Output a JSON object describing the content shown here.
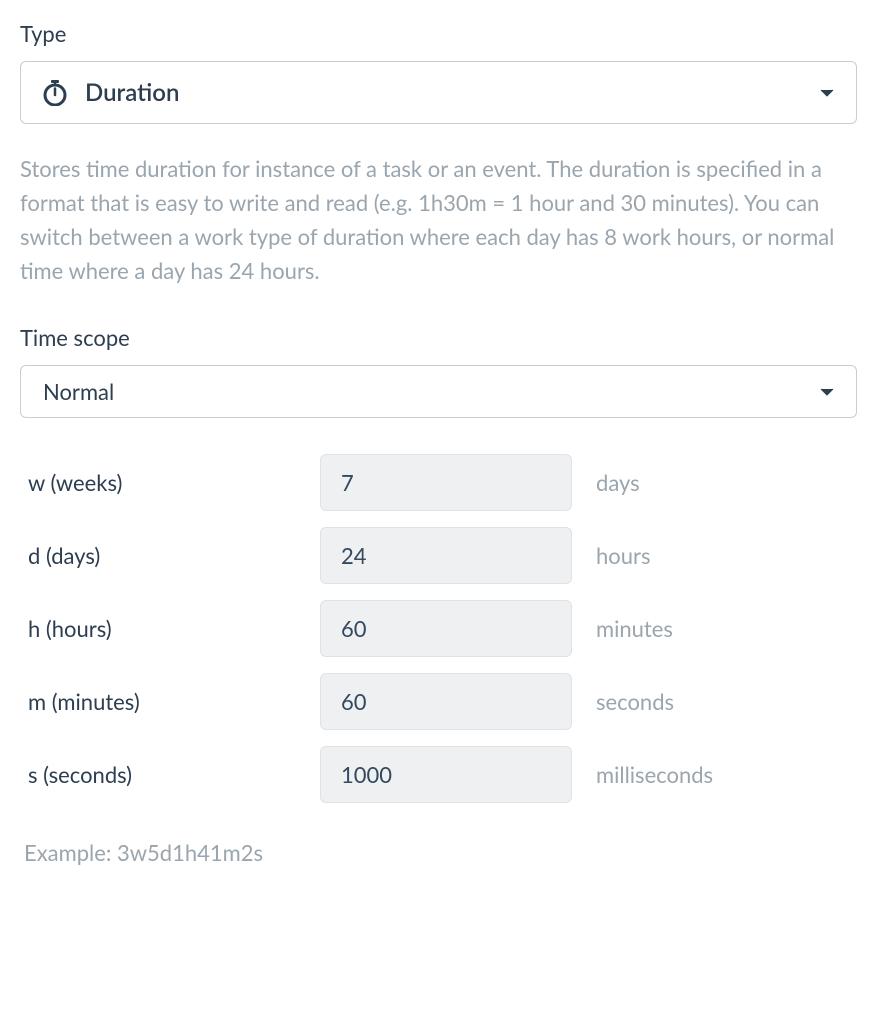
{
  "type": {
    "label": "Type",
    "selected": "Duration",
    "icon": "stopwatch"
  },
  "description": "Stores time duration for instance of a task or an event. The duration is specified in a format that is easy to write and read (e.g. 1h30m = 1 hour and 30 minutes). You can switch between a work type of duration where each day has 8 work hours, or normal time where a day has 24 hours.",
  "timescope": {
    "label": "Time scope",
    "selected": "Normal"
  },
  "units": [
    {
      "label": "w (weeks)",
      "value": "7",
      "suffix": "days"
    },
    {
      "label": "d (days)",
      "value": "24",
      "suffix": "hours"
    },
    {
      "label": "h (hours)",
      "value": "60",
      "suffix": "minutes"
    },
    {
      "label": "m (minutes)",
      "value": "60",
      "suffix": "seconds"
    },
    {
      "label": "s (seconds)",
      "value": "1000",
      "suffix": "milliseconds"
    }
  ],
  "example": {
    "prefix": "Example: ",
    "value": "3w5d1h41m2s"
  }
}
